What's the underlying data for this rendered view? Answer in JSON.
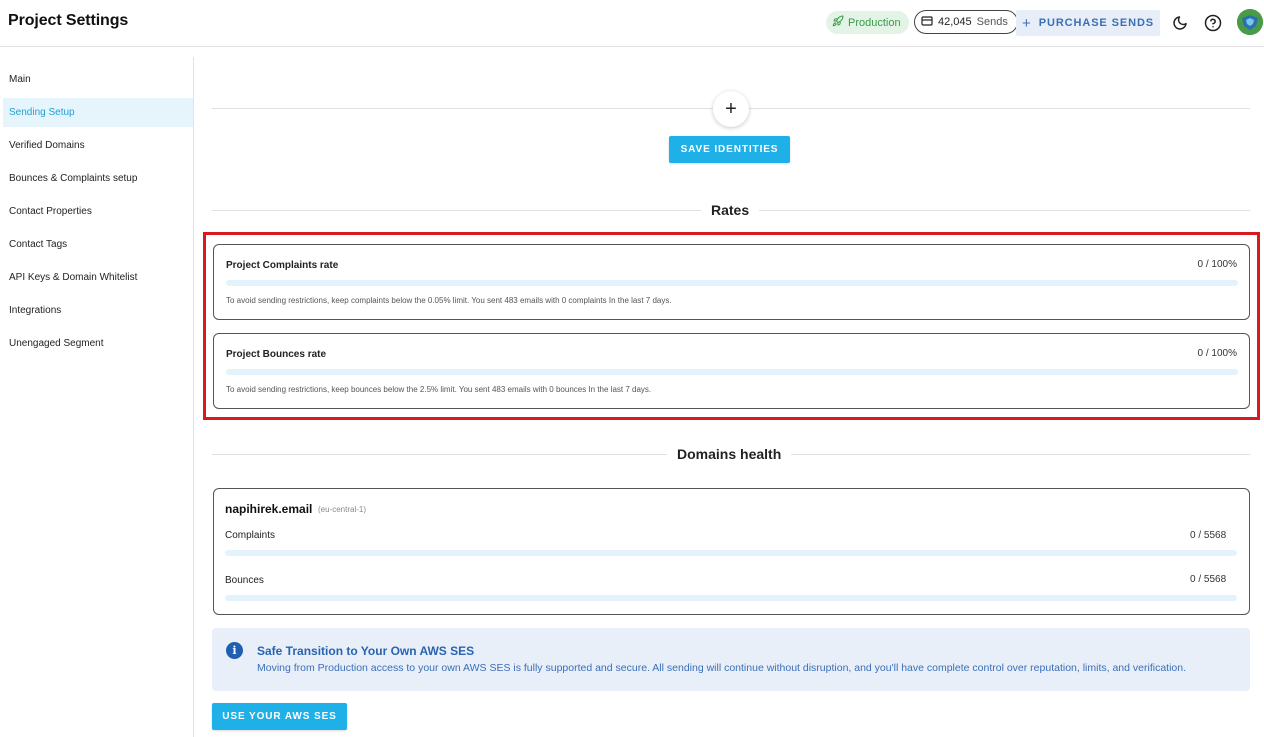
{
  "header": {
    "title": "Project Settings",
    "environment_badge": "Production",
    "sends_count": "42,045",
    "sends_unit": "Sends",
    "purchase_label": "PURCHASE SENDS",
    "icons": [
      "rocket-icon",
      "credit-card-icon",
      "plus-icon",
      "moon-icon",
      "help-icon",
      "avatar"
    ]
  },
  "sidebar": {
    "items": [
      {
        "label": "Main",
        "active": false
      },
      {
        "label": "Sending Setup",
        "active": true
      },
      {
        "label": "Verified Domains",
        "active": false
      },
      {
        "label": "Bounces & Complaints setup",
        "active": false
      },
      {
        "label": "Contact Properties",
        "active": false
      },
      {
        "label": "Contact Tags",
        "active": false
      },
      {
        "label": "API Keys & Domain Whitelist",
        "active": false
      },
      {
        "label": "Integrations",
        "active": false
      },
      {
        "label": "Unengaged Segment",
        "active": false
      }
    ]
  },
  "identities": {
    "add_symbol": "+",
    "save_label": "SAVE IDENTITIES"
  },
  "rates": {
    "title": "Rates",
    "complaints": {
      "label": "Project Complaints rate",
      "value": "0 / 100%",
      "progress": 0,
      "note": "To avoid sending restrictions, keep complaints below the 0.05% limit. You sent 483 emails with 0 complaints In the last 7 days."
    },
    "bounces": {
      "label": "Project Bounces rate",
      "value": "0 / 100%",
      "progress": 0,
      "note": "To avoid sending restrictions, keep bounces below the 2.5% limit. You sent 483 emails with 0 bounces In the last 7 days."
    }
  },
  "domains_health": {
    "title": "Domains health",
    "domain": "napihirek.email",
    "region": "(eu-central-1)",
    "complaints": {
      "label": "Complaints",
      "value": "0 / 5568",
      "progress": 0
    },
    "bounces": {
      "label": "Bounces",
      "value": "0 / 5568",
      "progress": 0
    }
  },
  "aws_info": {
    "title": "Safe Transition to Your Own AWS SES",
    "text": "Moving from Production access to your own AWS SES is fully supported and secure. All sending will continue without disruption, and you'll have complete control over reputation, limits, and verification.",
    "button_label": "USE YOUR AWS SES"
  },
  "colors": {
    "accent": "#1fb0e8",
    "highlight_border": "#d71920",
    "production_green": "#3a9a49",
    "info_blue": "#2a63b0"
  }
}
